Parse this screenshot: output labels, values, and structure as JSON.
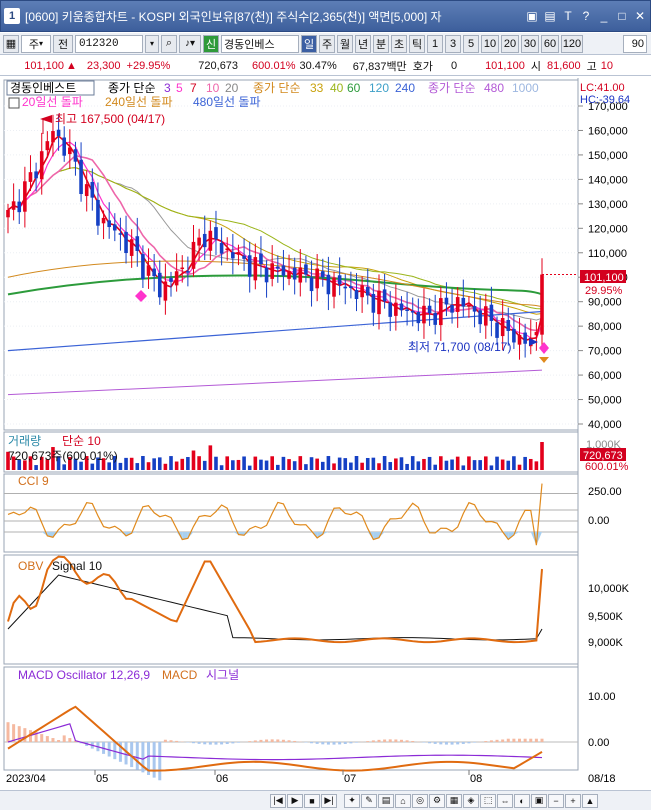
{
  "window": {
    "app_badge": "1",
    "title": "[0600] 키움종합차트 - KOSPI 외국인보유[87(천)] 주식수[2,365(천)] 액면[5,000] 자"
  },
  "toolbar": {
    "market": "주",
    "prev_label": "전",
    "code": "012320",
    "new_badge": "신",
    "stock_name": "경동인베스",
    "periods": [
      "일",
      "주",
      "월",
      "년",
      "분",
      "초",
      "틱"
    ],
    "selected_period": "일",
    "intervals": [
      "1",
      "3",
      "5",
      "10",
      "20",
      "30",
      "60",
      "120"
    ],
    "count": "90"
  },
  "quote": {
    "price": "101,100",
    "change": "23,300",
    "change_pct": "+29.95%",
    "volume": "720,673",
    "volume_ratio": "600.01%",
    "turnover": "30.47%",
    "amount": "67,837백만",
    "hoga_label": "호가",
    "hoga_value": "0",
    "hoga_price": "101,100",
    "open_label": "시",
    "open_price": "81,600",
    "high_label": "고",
    "high_price": "10"
  },
  "price_pane": {
    "stock_label": "경동인베스트",
    "ma_label": "종가 단순",
    "ma_periods": [
      "3",
      "5",
      "7",
      "10",
      "20"
    ],
    "ma2_label": "종가 단순",
    "ma2_periods": [
      "33",
      "40",
      "60",
      "120",
      "240"
    ],
    "ma3_label": "종가 단순",
    "ma3_periods": [
      "480",
      "1000"
    ],
    "breakouts": [
      "20일선 돌파",
      "240일선 돌파",
      "480일선 돌파"
    ],
    "lc": "LC:41.00",
    "hc": "HC:-39.64",
    "high_marker": "최고 167,500 (04/17)",
    "low_marker": "최저 71,700 (08/17)",
    "current_price_tag": "101,100",
    "current_pct_tag": "29.95%",
    "y_ticks": [
      "170,000",
      "160,000",
      "150,000",
      "140,000",
      "130,000",
      "120,000",
      "110,000",
      "100,000",
      "90,000",
      "80,000",
      "70,000",
      "60,000",
      "50,000",
      "40,000"
    ]
  },
  "volume_pane": {
    "label": "거래량",
    "ma_label": "단순 10",
    "value_text": "720,673주(600.01%)",
    "tag_value": "720,673",
    "tag_pct": "600.01%",
    "y_tick": "1,000K"
  },
  "cci_pane": {
    "label": "CCI 9",
    "y_ticks": [
      "250.00",
      "0.00"
    ]
  },
  "obv_pane": {
    "label": "OBV",
    "signal_label": "Signal 10",
    "y_ticks": [
      "10,000K",
      "9,500K",
      "9,000K"
    ]
  },
  "macd_pane": {
    "label": "MACD Oscillator 12,26,9",
    "macd_label": "MACD",
    "signal_label": "시그널",
    "y_ticks": [
      "10.00",
      "0.00"
    ]
  },
  "x_axis": {
    "labels": [
      "2023/04",
      "05",
      "06",
      "07",
      "08"
    ],
    "last_date": "08/18"
  },
  "colors": {
    "up": "#e3001b",
    "down": "#1540c4",
    "ma3": "#8b2ad6",
    "ma5": "#ff33cc",
    "ma20": "#ee66aa",
    "ma60": "#2c9b3b",
    "ma120": "#3ea0c8",
    "ma240": "#d2891d",
    "ma480": "#3b63d6",
    "ma1000": "#b35ad6"
  },
  "chart_data": {
    "type": "candlestick",
    "price_high": {
      "value": 167500,
      "date": "04/17"
    },
    "price_low": {
      "value": 71700,
      "date": "08/17"
    },
    "last_close": 101100,
    "last_change_pct": 29.95,
    "last_volume": 720673,
    "y_range": [
      35000,
      172000
    ],
    "x_labels": [
      "2023/04",
      "05",
      "06",
      "07",
      "08"
    ]
  }
}
